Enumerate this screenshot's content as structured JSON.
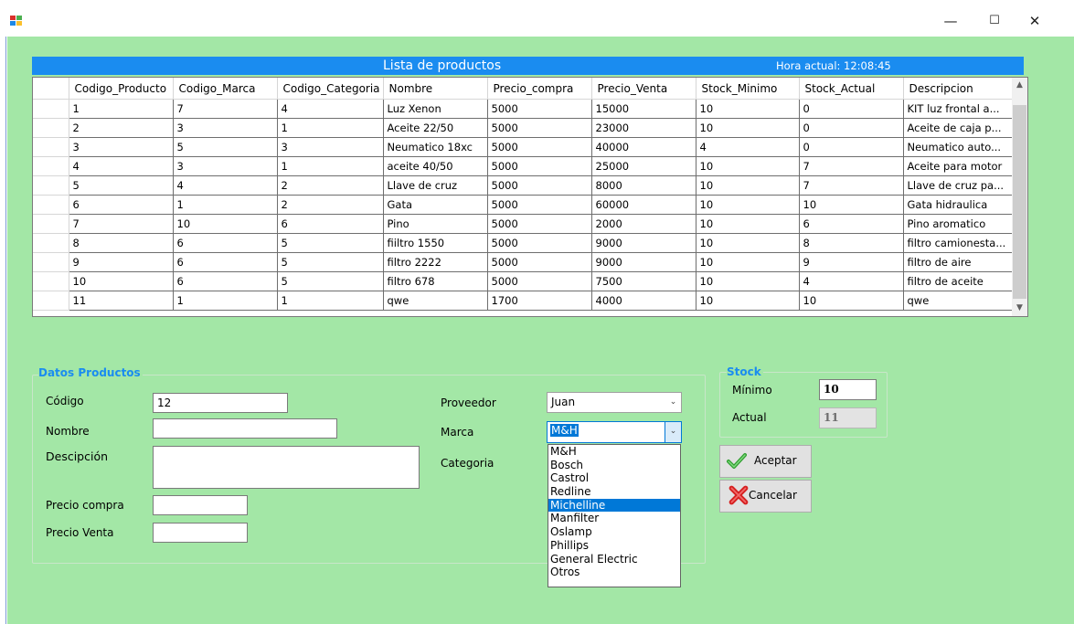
{
  "window": {
    "minimize_glyph": "—",
    "maximize_glyph": "☐",
    "close_glyph": "✕"
  },
  "header": {
    "title": "Lista de productos",
    "clock": "Hora actual: 12:08:45"
  },
  "grid": {
    "columns": [
      "Codigo_Producto",
      "Codigo_Marca",
      "Codigo_Categoria",
      "Nombre",
      "Precio_compra",
      "Precio_Venta",
      "Stock_Minimo",
      "Stock_Actual",
      "Descripcion"
    ],
    "rows": [
      [
        "1",
        "7",
        "4",
        "Luz Xenon",
        "5000",
        "15000",
        "10",
        "0",
        "KIT luz frontal a..."
      ],
      [
        "2",
        "3",
        "1",
        "Aceite 22/50",
        "5000",
        "23000",
        "10",
        "0",
        "Aceite de caja p..."
      ],
      [
        "3",
        "5",
        "3",
        "Neumatico 18xc",
        "5000",
        "40000",
        "4",
        "0",
        "Neumatico auto..."
      ],
      [
        "4",
        "3",
        "1",
        "aceite 40/50",
        "5000",
        "25000",
        "10",
        "7",
        "Aceite para motor"
      ],
      [
        "5",
        "4",
        "2",
        "Llave de cruz",
        "5000",
        "8000",
        "10",
        "7",
        "Llave de cruz pa..."
      ],
      [
        "6",
        "1",
        "2",
        "Gata",
        "5000",
        "60000",
        "10",
        "10",
        "Gata hidraulica"
      ],
      [
        "7",
        "10",
        "6",
        "Pino",
        "5000",
        "2000",
        "10",
        "6",
        "Pino aromatico"
      ],
      [
        "8",
        "6",
        "5",
        "fiiltro 1550",
        "5000",
        "9000",
        "10",
        "8",
        "filtro camionesta..."
      ],
      [
        "9",
        "6",
        "5",
        "filtro 2222",
        "5000",
        "9000",
        "10",
        "9",
        "filtro de aire"
      ],
      [
        "10",
        "6",
        "5",
        "filtro 678",
        "5000",
        "7500",
        "10",
        "4",
        "filtro de aceite"
      ],
      [
        "11",
        "1",
        "1",
        "qwe",
        "1700",
        "4000",
        "10",
        "10",
        "qwe"
      ]
    ]
  },
  "datos": {
    "legend": "Datos Productos",
    "codigo_label": "Código",
    "codigo_value": "12",
    "nombre_label": "Nombre",
    "nombre_value": "",
    "descripcion_label": "Descipción",
    "descripcion_value": "",
    "precio_compra_label": "Precio compra",
    "precio_compra_value": "",
    "precio_venta_label": "Precio Venta",
    "precio_venta_value": "",
    "proveedor_label": "Proveedor",
    "proveedor_value": "Juan",
    "marca_label": "Marca",
    "marca_value": "M&H",
    "categoria_label": "Categoria",
    "marca_options": [
      "M&H",
      "Bosch",
      "Castrol",
      "Redline",
      "Michelline",
      "Manfilter",
      "Oslamp",
      "Phillips",
      "General Electric",
      "Otros"
    ],
    "marca_highlighted": "Michelline"
  },
  "stock": {
    "legend": "Stock",
    "minimo_label": "Mínimo",
    "minimo_value": "10",
    "actual_label": "Actual",
    "actual_value": "11"
  },
  "buttons": {
    "aceptar": "Aceptar",
    "cancelar": "Cancelar"
  },
  "colors": {
    "background": "#a3e7a6",
    "header_bar": "#1a8cf0",
    "selection": "#0078d7"
  }
}
